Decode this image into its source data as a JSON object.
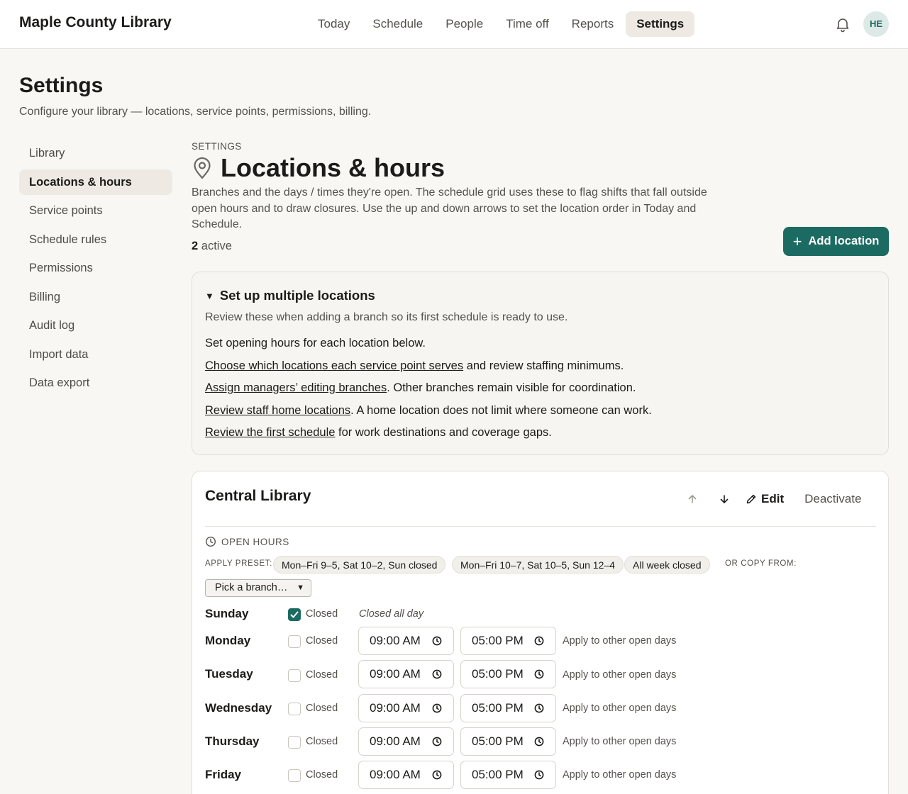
{
  "app": {
    "name": "Maple County Library",
    "nav": [
      {
        "label": "Today",
        "active": false
      },
      {
        "label": "Schedule",
        "active": false
      },
      {
        "label": "People",
        "active": false
      },
      {
        "label": "Time off",
        "active": false
      },
      {
        "label": "Reports",
        "active": false
      },
      {
        "label": "Settings",
        "active": true
      }
    ],
    "user_initials": "HE",
    "notification_icon": "bell-icon"
  },
  "page": {
    "title": "Settings",
    "subtitle": "Configure your library — locations, service points, permissions, billing."
  },
  "sidebar": {
    "items": [
      {
        "label": "Library",
        "active": false
      },
      {
        "label": "Locations & hours",
        "active": true
      },
      {
        "label": "Service points",
        "active": false
      },
      {
        "label": "Schedule rules",
        "active": false
      },
      {
        "label": "Permissions",
        "active": false
      },
      {
        "label": "Billing",
        "active": false
      },
      {
        "label": "Audit log",
        "active": false
      },
      {
        "label": "Import data",
        "active": false
      },
      {
        "label": "Data export",
        "active": false
      }
    ]
  },
  "section": {
    "eyebrow": "SETTINGS",
    "title": "Locations & hours",
    "icon": "map-pin-icon",
    "description": "Branches and the days / times they're open. The schedule grid uses these to flag shifts that fall outside open hours and to draw closures. Use the up and down arrows to set the location order in Today and Schedule.",
    "active_count": "2",
    "active_label": "active",
    "add_button": "Add location"
  },
  "setup": {
    "title": "Set up multiple locations",
    "subtitle": "Review these when adding a branch so its first schedule is ready to use.",
    "intro": "Set opening hours for each location below.",
    "steps": [
      {
        "link": "Choose which locations each service point serves",
        "rest": " and review staffing minimums."
      },
      {
        "link": "Assign managers’ editing branches",
        "rest": ". Other branches remain visible for coordination."
      },
      {
        "link": "Review staff home locations",
        "rest": ". A home location does not limit where someone can work."
      },
      {
        "link": "Review the first schedule",
        "rest": " for work destinations and coverage gaps."
      }
    ]
  },
  "location": {
    "name": "Central Library",
    "edit_label": "Edit",
    "deactivate_label": "Deactivate",
    "open_hours_label": "OPEN HOURS",
    "apply_preset_label": "APPLY PRESET:",
    "presets": [
      "Mon–Fri 9–5, Sat 10–2, Sun closed",
      "Mon–Fri 10–7, Sat 10–5, Sun 12–4",
      "All week closed"
    ],
    "copy_from_label": "OR COPY FROM:",
    "copy_select": "Pick a branch…",
    "closed_label": "Closed",
    "closed_all_day": "Closed all day",
    "apply_label": "Apply to other open days",
    "days": [
      {
        "day": "Sunday",
        "closed": true
      },
      {
        "day": "Monday",
        "closed": false,
        "open": "09:00 AM",
        "close": "05:00 PM"
      },
      {
        "day": "Tuesday",
        "closed": false,
        "open": "09:00 AM",
        "close": "05:00 PM"
      },
      {
        "day": "Wednesday",
        "closed": false,
        "open": "09:00 AM",
        "close": "05:00 PM"
      },
      {
        "day": "Thursday",
        "closed": false,
        "open": "09:00 AM",
        "close": "05:00 PM"
      },
      {
        "day": "Friday",
        "closed": false,
        "open": "09:00 AM",
        "close": "05:00 PM"
      }
    ]
  },
  "colors": {
    "accent": "#1c6b62",
    "background": "#f8f7f4",
    "active_tab": "#eeeae3"
  }
}
